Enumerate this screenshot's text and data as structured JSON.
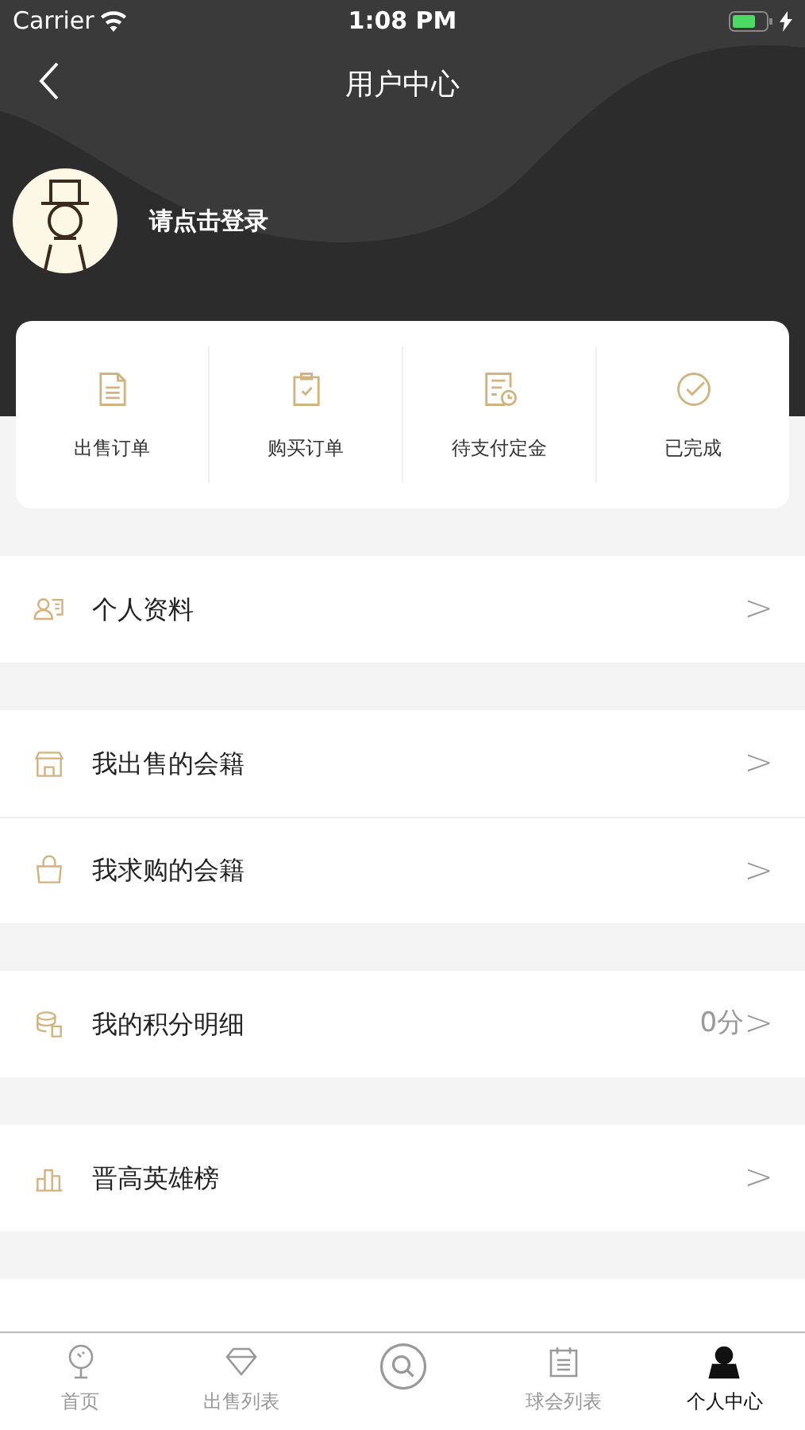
{
  "status_bar": {
    "carrier": "Carrier",
    "time": "1:08 PM"
  },
  "nav_bar": {
    "title": "用户中心"
  },
  "profile": {
    "login_prompt": "请点击登录"
  },
  "order_shortcuts": [
    {
      "kind": "document",
      "label": "出售订单"
    },
    {
      "kind": "clipboard",
      "label": "购买订单"
    },
    {
      "kind": "pending",
      "label": "待支付定金"
    },
    {
      "kind": "done",
      "label": "已完成"
    }
  ],
  "menu_groups": [
    {
      "items": [
        {
          "kind": "profile",
          "label": "个人资料",
          "arrow": ">"
        }
      ]
    },
    {
      "items": [
        {
          "kind": "store",
          "label": "我出售的会籍",
          "arrow": ">"
        },
        {
          "kind": "bag",
          "label": "我求购的会籍",
          "arrow": ">"
        }
      ]
    },
    {
      "items": [
        {
          "kind": "coins",
          "label": "我的积分明细",
          "value": "0分",
          "arrow": ">"
        }
      ]
    },
    {
      "items": [
        {
          "kind": "chart",
          "label": "晋高英雄榜",
          "arrow": ">"
        }
      ]
    }
  ],
  "tab_bar": [
    {
      "kind": "golf",
      "label": "首页",
      "selected": false
    },
    {
      "kind": "diamond",
      "label": "出售列表",
      "selected": false
    },
    {
      "kind": "search",
      "selected": false
    },
    {
      "kind": "calendar",
      "label": "球会列表",
      "selected": false
    },
    {
      "kind": "user",
      "label": "个人中心",
      "selected": true
    }
  ]
}
